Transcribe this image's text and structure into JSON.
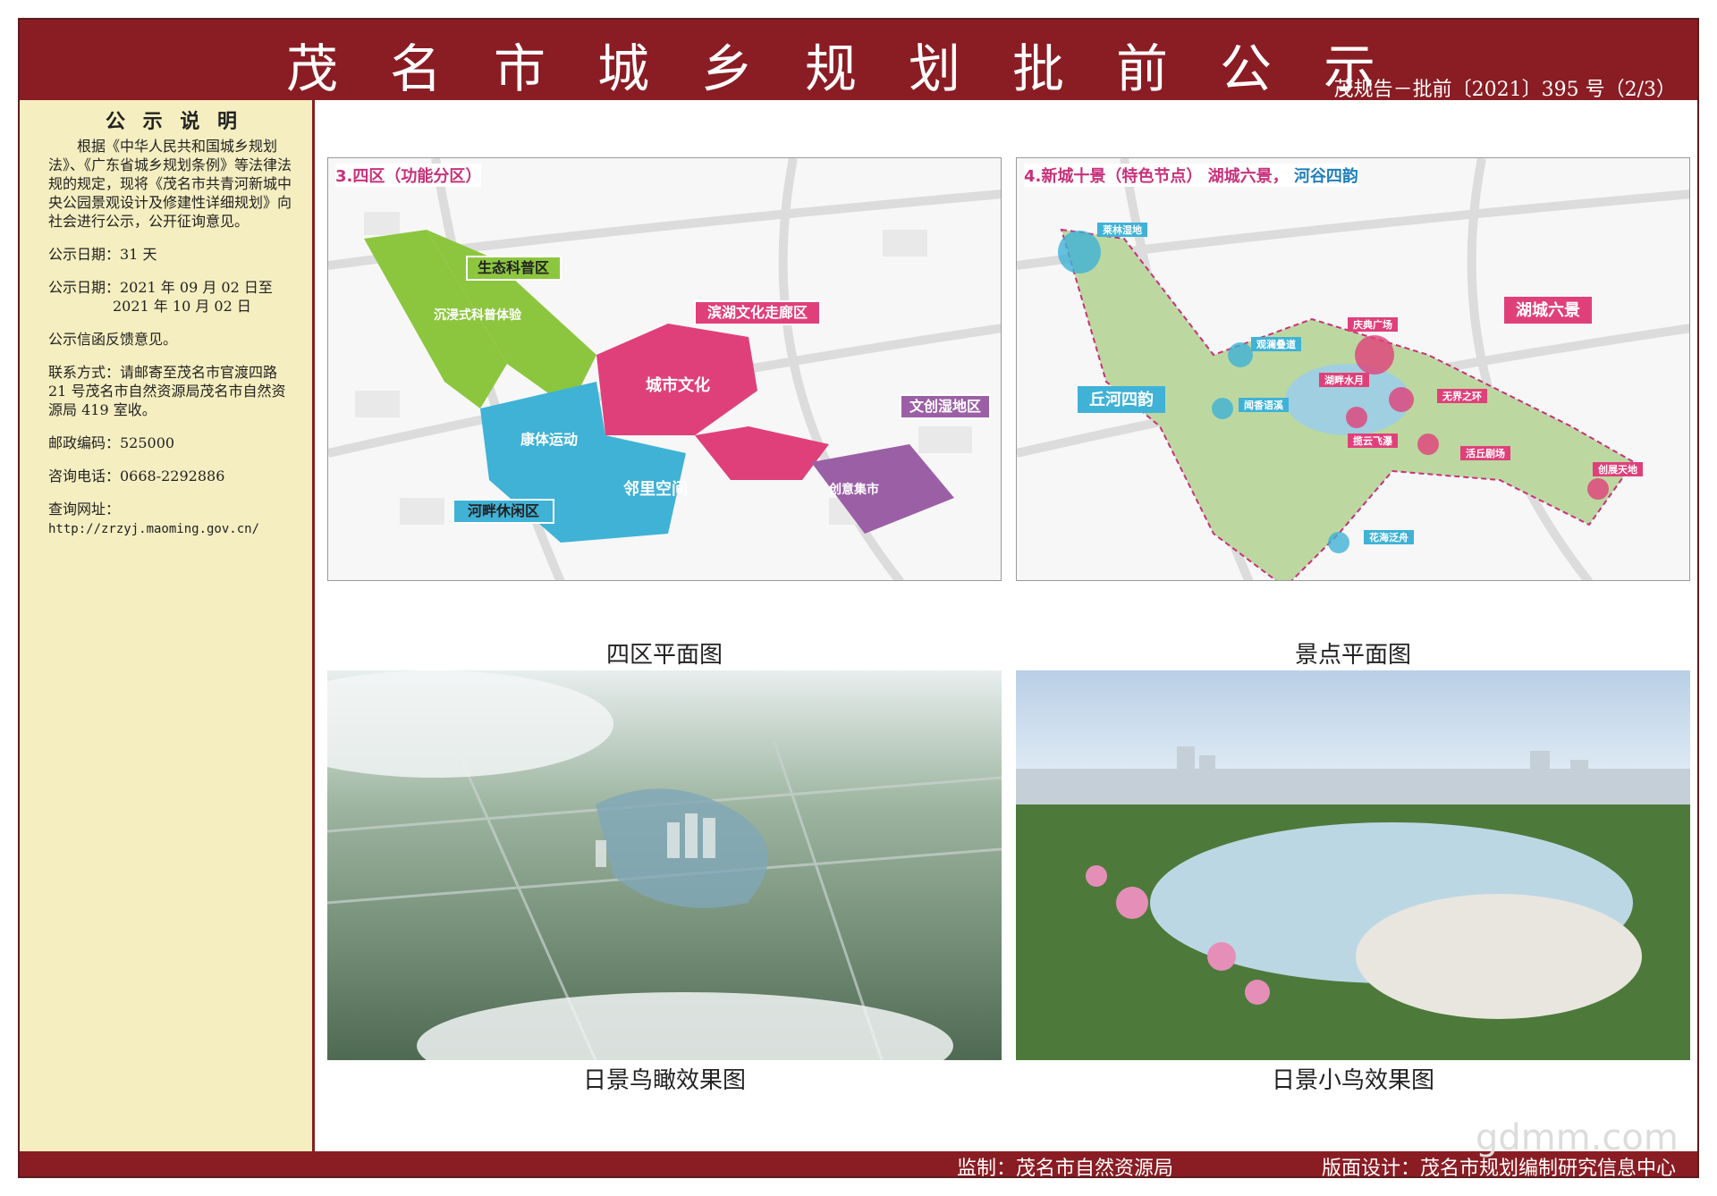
{
  "header": {
    "title": "茂名市城乡规划批前公示",
    "doc_no": "茂规告－批前〔2021〕395 号（2/3）"
  },
  "sidebar": {
    "heading": "公 示 说 明",
    "intro": "根据《中华人民共和国城乡规划法》、《广东省城乡规划条例》等法律法规的规定，现将《茂名市共青河新城中央公园景观设计及修建性详细规划》向社会进行公示，公开征询意见。",
    "duration": "公示日期：31 天",
    "dates_line1": "公示日期：2021 年 09 月 02 日至",
    "dates_line2": "2021 年 10 月 02 日",
    "feedback": "公示信函反馈意见。",
    "contact": "联系方式：请邮寄至茂名市官渡四路 21 号茂名市自然资源局茂名市自然资源局 419 室收。",
    "postcode": "邮政编码：525000",
    "phone": "咨询电话：0668-2292886",
    "url_label": "查询网址：",
    "url": "http://zrzyj.maoming.gov.cn/"
  },
  "panels": {
    "zone": {
      "heading": "3.四区（功能分区）",
      "caption": "四区平面图",
      "labels": {
        "eco": "生态科普区",
        "lake": "滨湖文化走廊区",
        "wetland": "文创湿地区",
        "river": "河畔休闲区",
        "city": "城市文化",
        "neighbor": "邻里空间",
        "sport": "康体运动",
        "market": "创意集市",
        "immersive": "沉浸式科普体验"
      }
    },
    "scenic": {
      "heading_a": "4.新城十景（特色节点）",
      "heading_b": "湖城六景，",
      "heading_c": "河谷四韵",
      "caption": "景点平面图",
      "tag_lake": "湖城六景",
      "tag_river": "丘河四韵",
      "spots": [
        "莱林湿地",
        "庆典广场",
        "观澜叠道",
        "湖畔水月",
        "无界之环",
        "闻香语溪",
        "揽云飞瀑",
        "活丘剧场",
        "创展天地",
        "花海泛舟"
      ]
    },
    "aerial": {
      "caption": "日景鸟瞰效果图"
    },
    "bird": {
      "caption": "日景小鸟效果图"
    }
  },
  "footer": {
    "supervisor": "监制：茂名市自然资源局",
    "designer": "版面设计：茂名市规划编制研究信息中心"
  },
  "watermark": "gdmm.com",
  "colors": {
    "brand_red": "#8a1c23",
    "sidebar_bg": "#f5eec0",
    "zone_green": "#8cc63f",
    "zone_pink": "#e0407a",
    "zone_blue": "#3fb2d6",
    "zone_purple": "#9b5fa6"
  }
}
